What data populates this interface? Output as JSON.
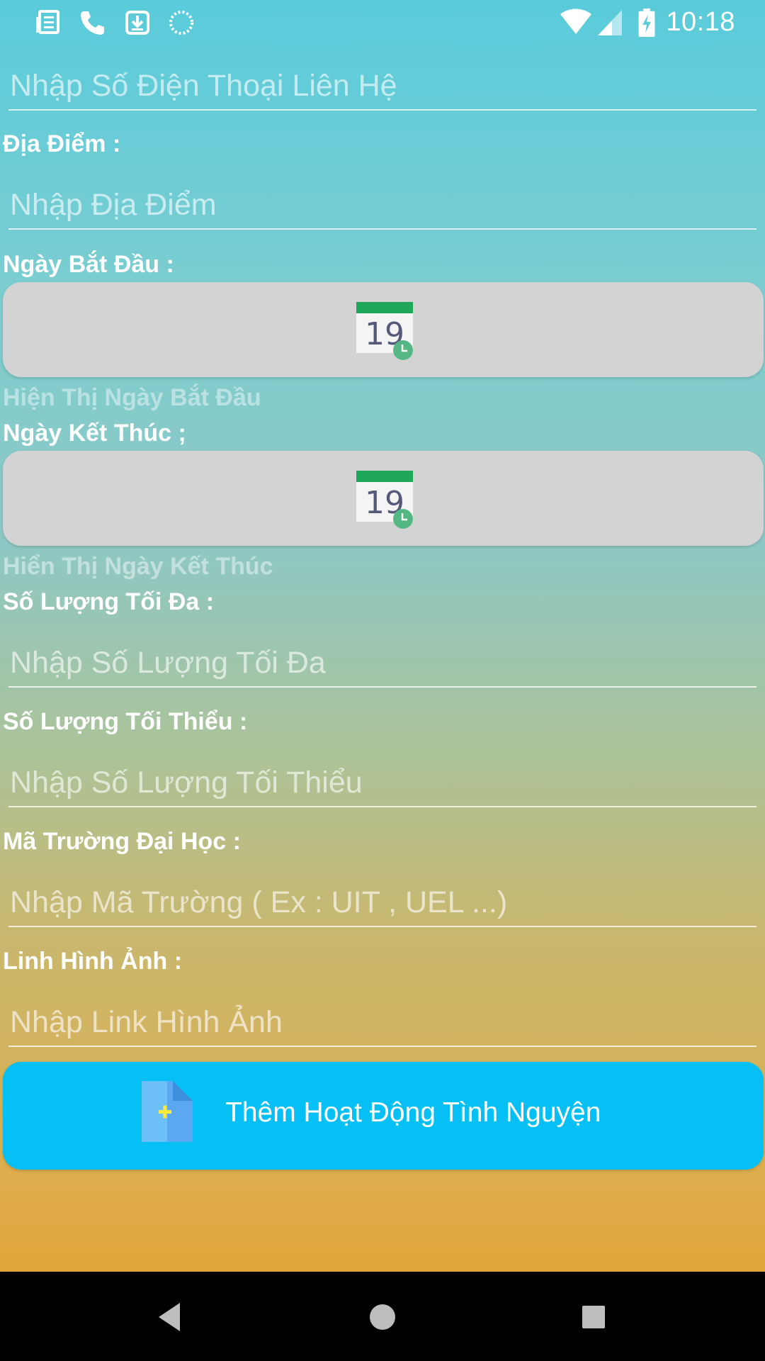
{
  "status_bar": {
    "time": "10:18",
    "icons": [
      "news-icon",
      "phone-icon",
      "download-icon",
      "sync-icon",
      "wifi-icon",
      "signal-icon",
      "battery-charging-icon"
    ]
  },
  "form": {
    "phone_placeholder": "Nhập Số Điện Thoại Liên Hệ",
    "location_label": "Địa Điểm :",
    "location_placeholder": "Nhập Địa Điểm",
    "start_date_label": "Ngày Bắt Đầu :",
    "start_date_display": "Hiện Thị Ngày Bắt Đầu",
    "end_date_label": "Ngày Kết Thúc ;",
    "end_date_display": "Hiển Thị Ngày Kết Thúc",
    "max_label": "Số Lượng Tối Đa :",
    "max_placeholder": "Nhập Số Lượng Tối Đa",
    "min_label": "Số Lượng Tối Thiểu :",
    "min_placeholder": "Nhập Số Lượng Tối Thiểu",
    "school_label": "Mã Trường Đại Học :",
    "school_placeholder": "Nhập Mã Trường ( Ex : UIT , UEL ...)",
    "image_label": "Linh Hình Ảnh :",
    "image_placeholder": "Nhập Link Hình Ảnh",
    "calendar_day": "19",
    "submit_label": "Thêm Hoạt Động Tình Nguyện"
  },
  "nav_bar": {
    "buttons": [
      "back-icon",
      "home-icon",
      "recents-icon"
    ]
  },
  "colors": {
    "submit_button": "#06c0f5",
    "date_button": "#d3d3d3",
    "calendar_header": "#21a75a",
    "gradient_top": "#59cbdb",
    "gradient_bottom": "#e89b2a"
  }
}
